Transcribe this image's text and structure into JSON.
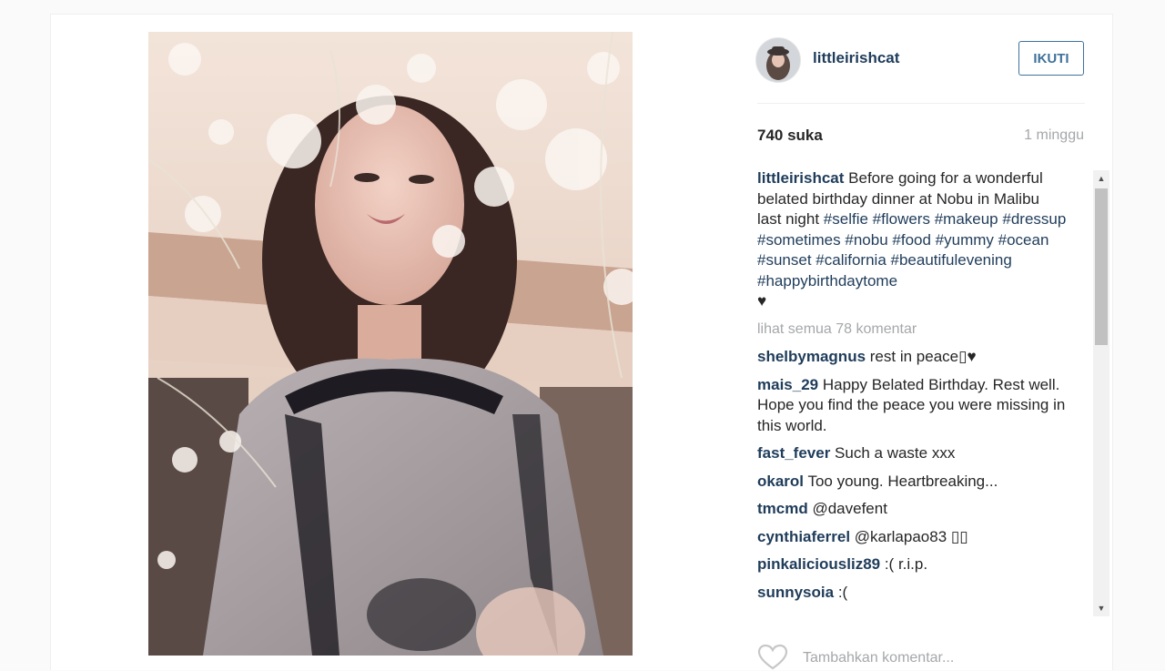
{
  "post": {
    "username": "littleirishcat",
    "follow_label": "IKUTI",
    "likes": "740 suka",
    "time": "1 minggu",
    "caption": {
      "text": "Before going for a wonderful belated birthday dinner at Nobu in Malibu last night",
      "hashtags": [
        "#selfie",
        "#flowers",
        "#makeup",
        "#dressup",
        "#sometimes",
        "#nobu",
        "#food",
        "#yummy",
        "#ocean",
        "#sunset",
        "#california",
        "#beautifulevening",
        "#happybirthdaytome"
      ],
      "emoji": "♥"
    },
    "view_all": "lihat semua 78 komentar",
    "comments": [
      {
        "user": "shelbymagnus",
        "text": "rest in peace▯♥"
      },
      {
        "user": "mais_29",
        "text": "Happy Belated Birthday. Rest well. Hope you find the peace you were missing in this world."
      },
      {
        "user": "fast_fever",
        "text": "Such a waste xxx"
      },
      {
        "user": "okarol",
        "text": "Too young. Heartbreaking..."
      },
      {
        "user": "tmcmd",
        "text": "@davefent"
      },
      {
        "user": "cynthiaferrel",
        "text": "@karlapao83 ▯▯"
      },
      {
        "user": "pinkaliciousliz89",
        "text": ":( r.i.p."
      },
      {
        "user": "sunnysoia",
        "text": ":("
      }
    ],
    "add_comment_placeholder": "Tambahkan komentar..."
  },
  "icons": {
    "heart": "heart-outline-icon",
    "scroll_up": "triangle-up",
    "scroll_down": "triangle-down"
  },
  "colors": {
    "link": "#1f3c5a",
    "follow": "#3f729b",
    "muted": "#a5a7aa",
    "background": "#fafafa"
  }
}
